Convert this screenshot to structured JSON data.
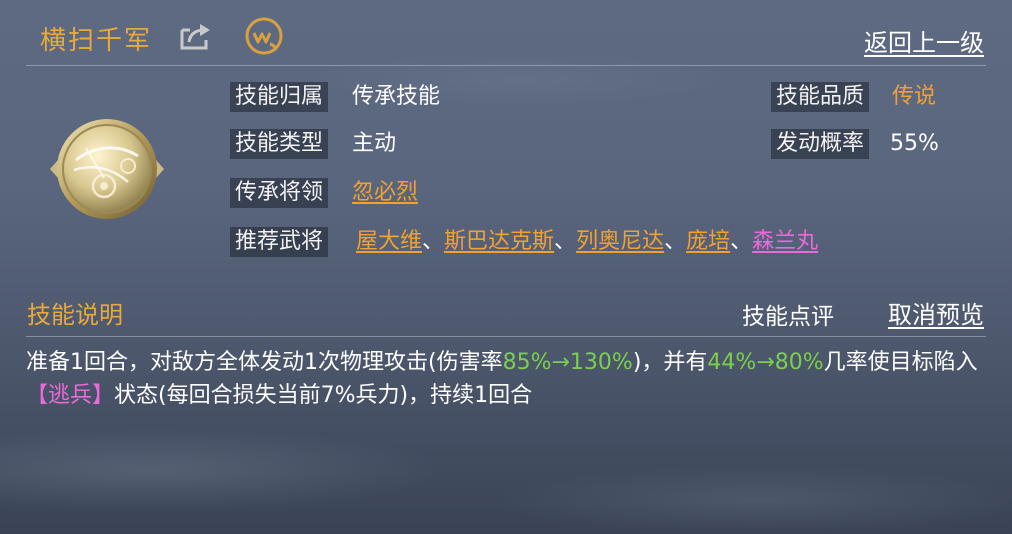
{
  "skill": {
    "name": "横扫千军",
    "back_label": "返回上一级"
  },
  "icons": {
    "share": "share-icon",
    "weibo": "weibo-icon",
    "emblem": "skill-emblem-icon"
  },
  "info": {
    "belong_label": "技能归属",
    "belong_value": "传承技能",
    "type_label": "技能类型",
    "type_value": "主动",
    "inherit_label": "传承将领",
    "inherit_value": "忽必烈",
    "recommend_label": "推荐武将",
    "recommend": [
      "屋大维",
      "斯巴达克斯",
      "列奥尼达",
      "庞培",
      "森兰丸"
    ],
    "separator": "、",
    "quality_label": "技能品质",
    "quality_value": "传说",
    "chance_label": "发动概率",
    "chance_value": "55%"
  },
  "section": {
    "title": "技能说明",
    "review_label": "技能点评",
    "cancel_label": "取消预览"
  },
  "description": {
    "p1": "准备1回合，对敌方全体发动1次物理攻击(伤害率",
    "h1": "85%→130%",
    "p2": ")，并有",
    "h2": "44%→80%",
    "p3": "几率使目标陷入",
    "status": "【逃兵】",
    "p4": "状态(每回合损失当前7%兵力)，持续1回合"
  },
  "colors": {
    "title_orange": "#e8a93a",
    "value_orange": "#f2a12e",
    "highlight_green": "#7ad04a",
    "highlight_pink": "#e96ad8"
  }
}
